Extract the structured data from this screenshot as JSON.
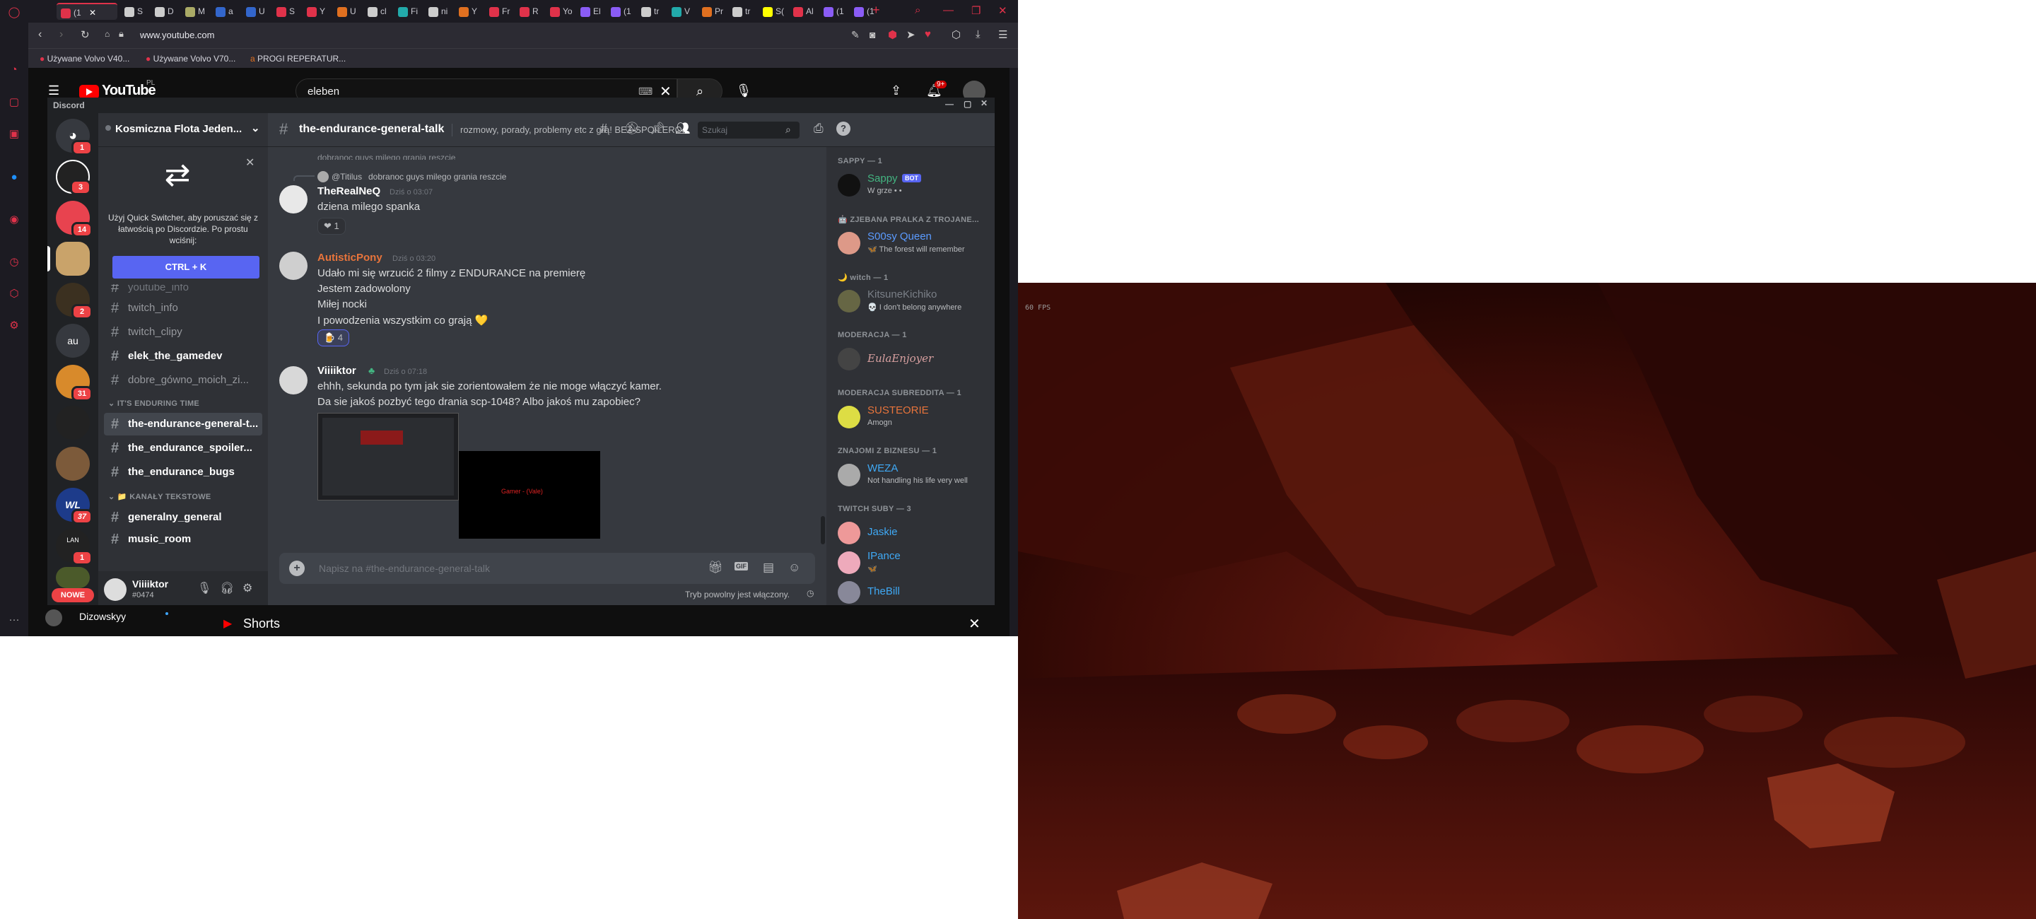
{
  "browser": {
    "url": "www.youtube.com",
    "active_tab_label": "(1",
    "tabs": [
      "(1",
      "S",
      "D",
      "M",
      "a",
      "U",
      "S",
      "Y",
      "U",
      "cl",
      "Fi",
      "ni",
      "Y",
      "Fr",
      "R",
      "Yo",
      "El",
      "(1",
      "tr",
      "V",
      "Pr",
      "tr",
      "S(",
      "Al",
      "(1",
      "(1"
    ],
    "bookmarks": [
      "Używane Volvo V40...",
      "Używane Volvo V70...",
      "PROGI REPERATUR..."
    ],
    "new_tab": "+"
  },
  "youtube": {
    "logo": "YouTube",
    "country": "PL",
    "search_value": "eleben",
    "notif_count": "9+",
    "bottom_user": "Dizowskyy",
    "shorts": "Shorts"
  },
  "discord": {
    "window_title": "Discord",
    "server_name": "Kosmiczna Flota Jeden...",
    "quick_switcher": {
      "text": "Użyj Quick Switcher, aby poruszać się z łatwością po Discordzie. Po prostu wciśnij:",
      "button": "CTRL + K"
    },
    "guild_badges": [
      "1",
      "3",
      "14",
      "2",
      "31",
      "37",
      "1"
    ],
    "guild_au": "au",
    "nowe": "NOWE",
    "channels_top": [
      "youtube_info",
      "twitch_info",
      "twitch_clipy",
      "elek_the_gamedev",
      "dobre_gówno_moich_zi..."
    ],
    "category1": "IT'S ENDURING TIME",
    "channels_mid": [
      "the-endurance-general-t...",
      "the_endurance_spoiler...",
      "the_endurance_bugs"
    ],
    "category2": "KANAŁY TEKSTOWE",
    "channels_bottom": [
      "generalny_general",
      "music_room"
    ],
    "user": {
      "name": "Viiiiktor",
      "tag": "#0474"
    },
    "channel": {
      "name": "the-endurance-general-talk",
      "topic": "rozmowy, porady, problemy etc z grą! BEZ SPOILERO...",
      "search_placeholder": "Szukaj"
    },
    "messages": {
      "cut_top": "dobranoc guys milego grania reszcie",
      "reply_name": "@Titilus",
      "reply_text": "dobranoc guys milego grania reszcie",
      "m1": {
        "author": "TheRealNeQ",
        "time": "Dziś o 03:07",
        "lines": [
          "dziena milego spanka"
        ],
        "reaction": "❤ 1"
      },
      "m2": {
        "author": "AutisticPony",
        "time": "Dziś o 03:20",
        "lines": [
          "Udało mi się wrzucić 2 filmy z ENDURANCE na premierę",
          "Jestem zadowolony",
          "Miłej nocki",
          "I powodzenia wszystkim co grają 💛"
        ],
        "reaction": "🍺 4"
      },
      "m3": {
        "author": "Viiiiktor",
        "time": "Dziś o 07:18",
        "lines": [
          "ehhh, sekunda po tym jak sie zorientowałem że nie moge włączyć kamer.",
          "Da sie jakoś pozbyć tego drania scp-1048? Albo jakoś mu zapobiec?"
        ],
        "image_text": "Gamer - (Vale)"
      }
    },
    "composer_placeholder": "Napisz na #the-endurance-general-talk",
    "slowmode": "Tryb powolny jest włączony.",
    "members": {
      "groups": [
        {
          "title": "SAPPY — 1",
          "members": [
            {
              "name": "Sappy",
              "badge": "BOT",
              "status": "W grze • •",
              "color": "#43b581"
            }
          ]
        },
        {
          "title": "🤖 ZJEBANA PRALKA Z TROJANE...",
          "members": [
            {
              "name": "S00sy Queen",
              "status": "🦋 The forest will remember",
              "color": "#5b9bff"
            }
          ]
        },
        {
          "title": "🌙 witch — 1",
          "members": [
            {
              "name": "KitsuneKichiko",
              "status": "💀 I don't belong anywhere",
              "color": "#7a7f87"
            }
          ]
        },
        {
          "title": "MODERACJA — 1",
          "members": [
            {
              "name": "EulaEnjoyer",
              "status": "",
              "color": "#d8a0a0"
            }
          ]
        },
        {
          "title": "MODERACJA SUBREDDITA — 1",
          "members": [
            {
              "name": "SUSTEORIE",
              "status": "Amogn",
              "color": "#e8743b"
            }
          ]
        },
        {
          "title": "ZNAJOMI Z BIZNESU — 1",
          "members": [
            {
              "name": "WEZA",
              "status": "Not handling his life very well",
              "color": "#3fa9f5"
            }
          ]
        },
        {
          "title": "TWITCH SUBY — 3",
          "members": [
            {
              "name": "Jaskie",
              "status": "",
              "color": "#3fa9f5"
            },
            {
              "name": "IPance",
              "status": "🦋",
              "color": "#3fa9f5"
            },
            {
              "name": "TheBill",
              "status": "",
              "color": "#3fa9f5"
            }
          ]
        }
      ]
    }
  },
  "game": {
    "fps": "60 FPS"
  }
}
